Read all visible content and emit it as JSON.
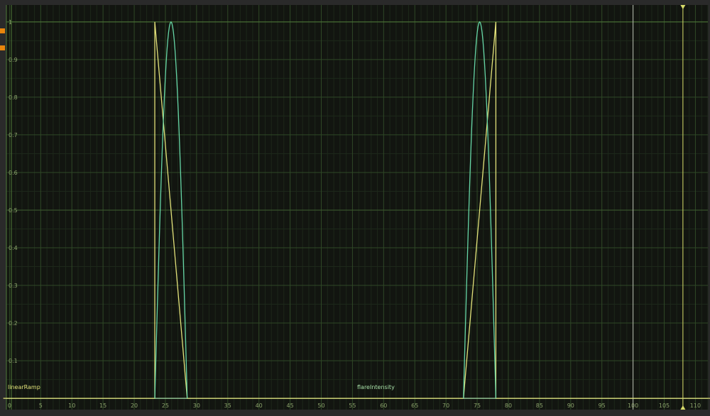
{
  "colors": {
    "background": "#121510",
    "frame": "#2a2a2a",
    "minor_grid": "#1d281a",
    "major_grid": "#2f4826",
    "axis": "#4e7a38",
    "linear_ramp": "#e2e27a",
    "flare_intensity": "#66d6a6",
    "baseline": "#a8e0a8",
    "playhead": "#d8dc6a",
    "marker": "#e8850c",
    "end_line": "#b8bcb0"
  },
  "curves": {
    "linear_ramp_label": "linearRamp",
    "flare_intensity_label": "flareIntensity"
  },
  "markers": [
    "key-marker",
    "key-marker"
  ],
  "chart_data": {
    "type": "line",
    "xlim": [
      -0.5,
      112
    ],
    "ylim": [
      -0.03,
      1.045
    ],
    "x_ticks": [
      0,
      5,
      10,
      15,
      20,
      25,
      30,
      35,
      40,
      45,
      50,
      55,
      60,
      65,
      70,
      75,
      80,
      85,
      90,
      95,
      100,
      105,
      110
    ],
    "y_ticks": [
      0.1,
      0.2,
      0.3,
      0.4,
      0.5,
      0.6,
      0.7,
      0.8,
      0.9,
      1
    ],
    "grid": true,
    "playhead_frame": 108,
    "end_frame": 100,
    "series": [
      {
        "name": "linearRamp",
        "color": "#e2e27a",
        "x": [
          -1,
          23.3,
          23.3,
          28.5,
          72.8,
          78.0,
          78.0,
          113
        ],
        "y": [
          0,
          0,
          1,
          0,
          0,
          1,
          0,
          0
        ]
      },
      {
        "name": "flareIntensity",
        "color": "#66d6a6",
        "shape": "sine-pulse",
        "x": [
          -1,
          23.3,
          25.9,
          28.5,
          72.8,
          75.4,
          78.0,
          113
        ],
        "y": [
          0,
          0,
          1,
          0,
          0,
          1,
          0,
          0
        ]
      }
    ]
  }
}
